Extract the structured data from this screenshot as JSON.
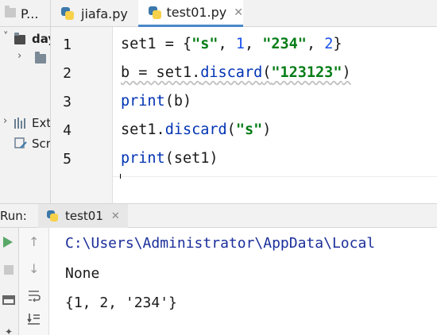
{
  "project_pane": {
    "title": "P...",
    "items": [
      {
        "label": "day"
      },
      {
        "label": ""
      },
      {
        "label": "Ext"
      },
      {
        "label": "Scr"
      }
    ]
  },
  "tabs": [
    {
      "label": "jiafa.py",
      "active": false
    },
    {
      "label": "test01.py",
      "active": true
    }
  ],
  "editor": {
    "line_numbers": [
      "1",
      "2",
      "3",
      "4",
      "5"
    ],
    "lines": [
      "set1 = {\"s\", 1, \"234\", 2}",
      "b = set1.discard(\"123123\")",
      "print(b)",
      "set1.discard(\"s\")",
      "print(set1)"
    ]
  },
  "run": {
    "label": "Run:",
    "tab_label": "test01",
    "output": [
      "C:\\Users\\Administrator\\AppData\\Local",
      "None",
      "{1, 2, '234'}"
    ]
  },
  "colors": {
    "string": "#067d17",
    "number": "#1750eb",
    "function": "#0033b3",
    "path": "#1a2e9a",
    "run_green": "#59a869",
    "tab_underline": "#4a88c7"
  },
  "icons": [
    "folder-icon",
    "python-file-icon",
    "close-icon",
    "run-icon",
    "stop-icon",
    "scroll-up-icon",
    "scroll-down-icon",
    "soft-wrap-icon",
    "scroll-to-end-icon",
    "layout-icon",
    "pin-icon",
    "library-icon",
    "scratch-icon"
  ]
}
